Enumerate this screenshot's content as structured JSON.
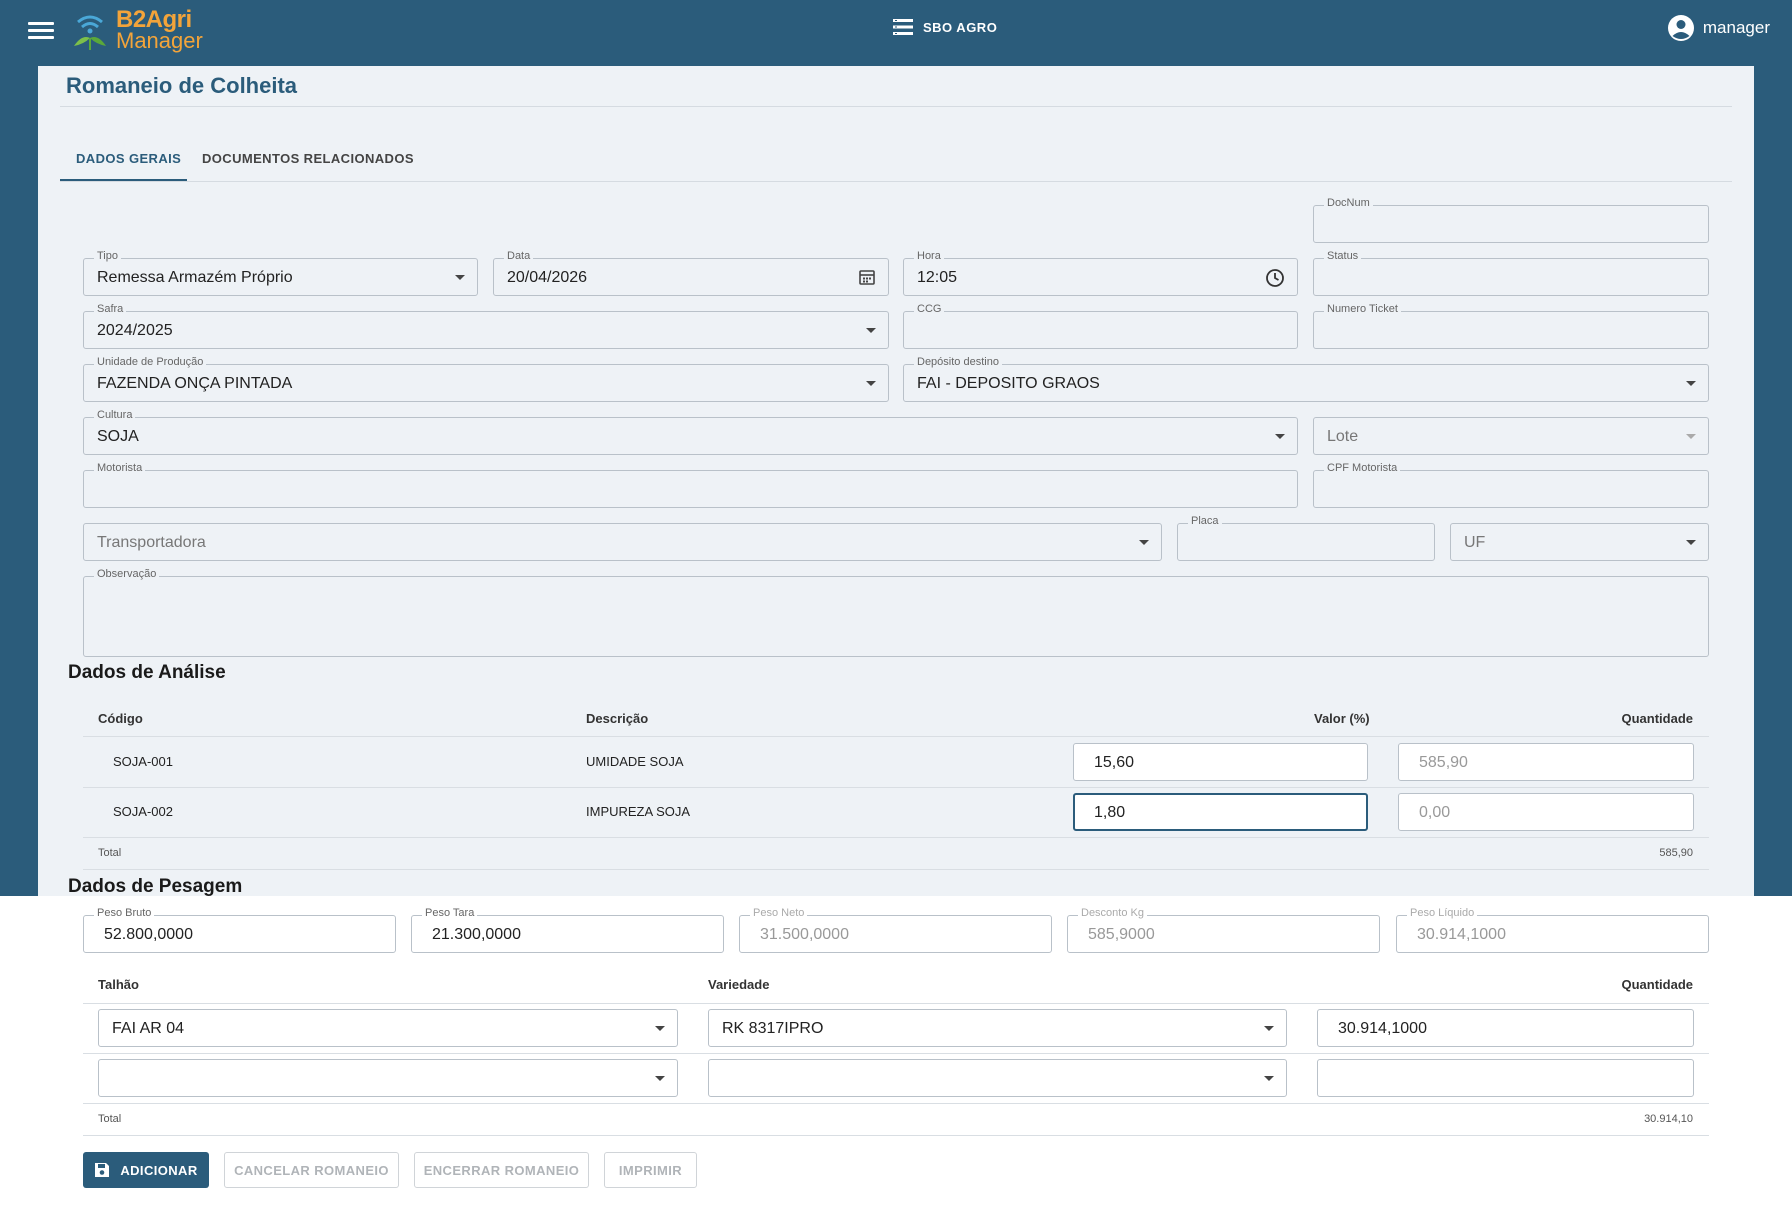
{
  "header": {
    "logo_line1": "B2Agri",
    "logo_line2": "Manager",
    "company": "SBO AGRO",
    "user": "manager"
  },
  "page": {
    "title": "Romaneio de Colheita",
    "tabs": [
      {
        "label": "DADOS GERAIS",
        "active": true
      },
      {
        "label": "DOCUMENTOS RELACIONADOS",
        "active": false
      }
    ]
  },
  "form": {
    "docnum": {
      "label": "DocNum",
      "value": ""
    },
    "tipo": {
      "label": "Tipo",
      "value": "Remessa Armazém Próprio"
    },
    "data": {
      "label": "Data",
      "value": "20/04/2026"
    },
    "hora": {
      "label": "Hora",
      "value": "12:05"
    },
    "status": {
      "label": "Status",
      "value": ""
    },
    "safra": {
      "label": "Safra",
      "value": "2024/2025"
    },
    "ccg": {
      "label": "CCG",
      "value": ""
    },
    "numero_ticket": {
      "label": "Numero Ticket",
      "value": ""
    },
    "unidade_producao": {
      "label": "Unidade de Produção",
      "value": "FAZENDA ONÇA PINTADA"
    },
    "deposito_destino": {
      "label": "Depósito destino",
      "value": "FAI - DEPOSITO GRAOS"
    },
    "cultura": {
      "label": "Cultura",
      "value": "SOJA"
    },
    "lote": {
      "placeholder": "Lote"
    },
    "motorista": {
      "label": "Motorista",
      "value": ""
    },
    "cpf_motorista": {
      "label": "CPF Motorista",
      "value": ""
    },
    "transportadora": {
      "placeholder": "Transportadora"
    },
    "placa": {
      "label": "Placa",
      "value": ""
    },
    "uf": {
      "placeholder": "UF"
    },
    "observacao": {
      "label": "Observação",
      "value": ""
    }
  },
  "analise": {
    "title": "Dados de Análise",
    "headers": {
      "codigo": "Código",
      "descricao": "Descrição",
      "valor": "Valor (%)",
      "quantidade": "Quantidade"
    },
    "rows": [
      {
        "codigo": "SOJA-001",
        "descricao": "UMIDADE SOJA",
        "valor": "15,60",
        "quantidade": "585,90"
      },
      {
        "codigo": "SOJA-002",
        "descricao": "IMPUREZA SOJA",
        "valor": "1,80",
        "quantidade": "0,00"
      }
    ],
    "total_label": "Total",
    "total_value": "585,90"
  },
  "pesagem": {
    "title": "Dados de Pesagem",
    "peso_bruto": {
      "label": "Peso Bruto",
      "value": "52.800,0000"
    },
    "peso_tara": {
      "label": "Peso Tara",
      "value": "21.300,0000"
    },
    "peso_neto": {
      "label": "Peso Neto",
      "value": "31.500,0000"
    },
    "desconto_kg": {
      "label": "Desconto Kg",
      "value": "585,9000"
    },
    "peso_liquido": {
      "label": "Peso Líquido",
      "value": "30.914,1000"
    },
    "headers": {
      "talhao": "Talhão",
      "variedade": "Variedade",
      "quantidade": "Quantidade"
    },
    "rows": [
      {
        "talhao": "FAI AR 04",
        "variedade": "RK 8317IPRO",
        "quantidade": "30.914,1000"
      },
      {
        "talhao": "",
        "variedade": "",
        "quantidade": ""
      }
    ],
    "total_label": "Total",
    "total_value": "30.914,10"
  },
  "actions": {
    "adicionar": "ADICIONAR",
    "cancelar": "CANCELAR ROMANEIO",
    "encerrar": "ENCERRAR ROMANEIO",
    "imprimir": "IMPRIMIR"
  },
  "colors": {
    "primary": "#2b5c7b",
    "accent": "#f3a43a"
  }
}
